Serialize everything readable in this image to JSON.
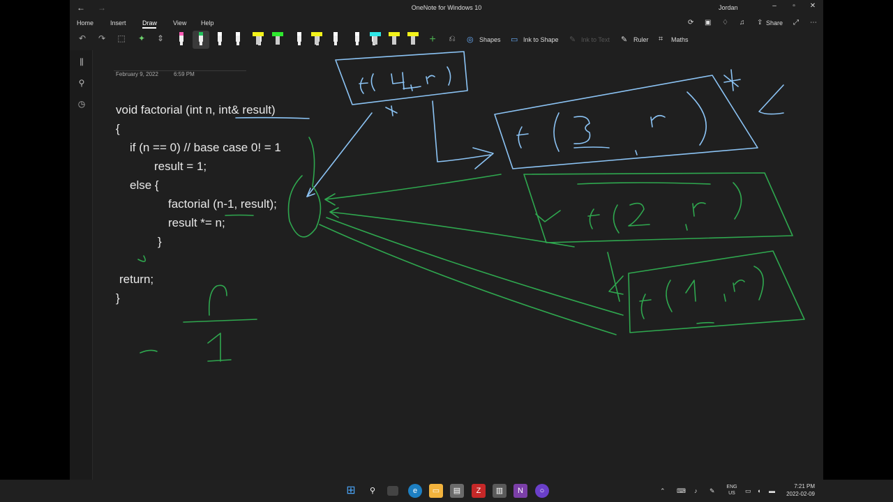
{
  "window": {
    "title": "OneNote for Windows 10",
    "user": "Jordan",
    "back_glyph": "←",
    "forward_glyph": "→",
    "minimize_glyph": "–",
    "restore_glyph": "▫",
    "close_glyph": "✕"
  },
  "menu": {
    "tabs": [
      "Home",
      "Insert",
      "Draw",
      "View",
      "Help"
    ],
    "active_tab": "Draw",
    "share_label": "Share"
  },
  "toolbar": {
    "shapes_label": "Shapes",
    "ink_to_shape_label": "Ink to Shape",
    "ink_to_text_label": "Ink to Text",
    "ruler_label": "Ruler",
    "maths_label": "Maths",
    "pen_colors": [
      "#ff5ab4",
      "#22c55e",
      "#ffffff",
      "#ffffff",
      "#ffffff",
      "#ffffff",
      "#ffffff",
      "#ffffff",
      "#ffffff",
      "#ffffff"
    ],
    "highlighter_colors": [
      "#f2f21a",
      "#2ee82e",
      "#f2f21a",
      "#2ee8e8",
      "#f2f21a",
      "#f2f21a"
    ]
  },
  "page": {
    "date": "February 9, 2022",
    "time": "6:59 PM",
    "code_lines": [
      "void factorial (int n, int& result)",
      "{",
      "if (n == 0) // base case 0! = 1",
      "result = 1;",
      "else {",
      "factorial (n-1, result);",
      "result *= n;",
      "}",
      "return;",
      "}"
    ]
  },
  "ink_colors": {
    "blue": "#8cc4f5",
    "green": "#2fa84f"
  },
  "taskbar": {
    "language_top": "ENG",
    "language_bottom": "US",
    "time": "7:21 PM",
    "date": "2022-02-09"
  }
}
